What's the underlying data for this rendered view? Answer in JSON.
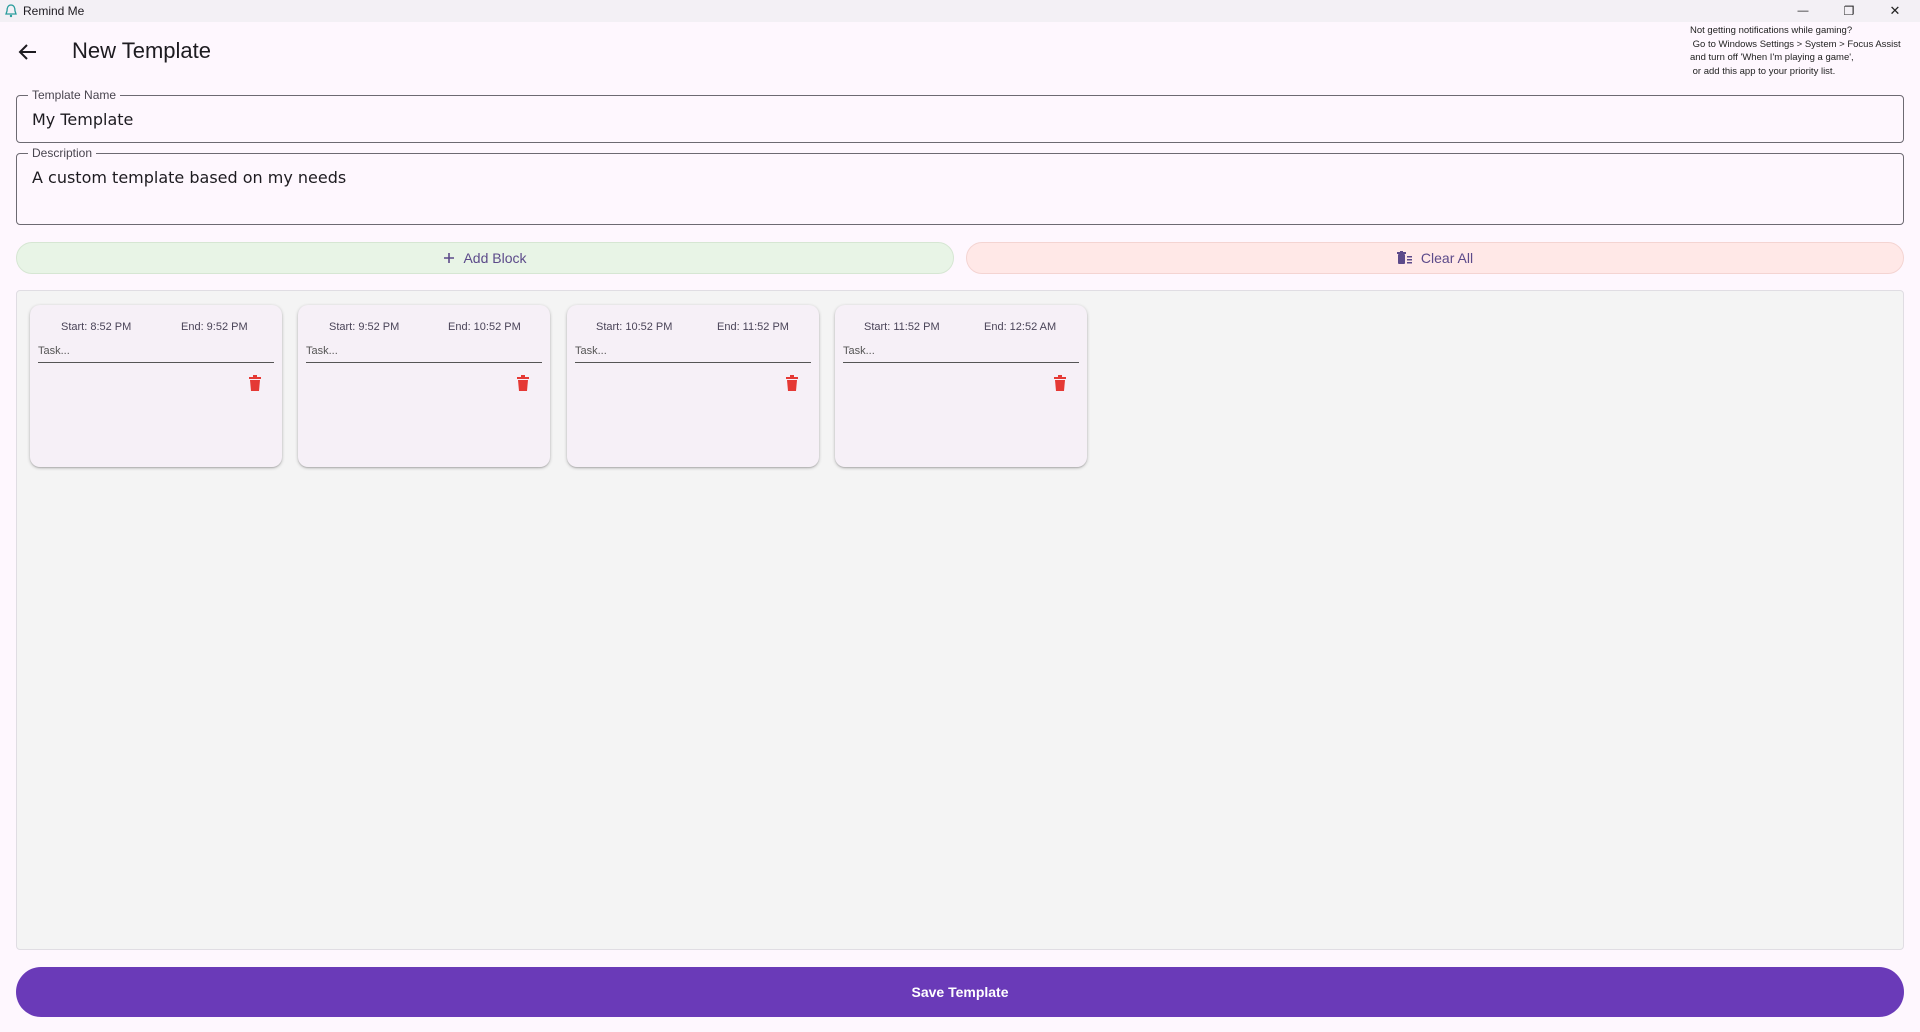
{
  "window": {
    "title": "Remind Me",
    "minimize_glyph": "—",
    "maximize_glyph": "❐",
    "close_glyph": "✕"
  },
  "header": {
    "title": "New Template",
    "back_icon": "arrow-left-icon"
  },
  "notice": {
    "text": "Not getting notifications while gaming?\n Go to Windows Settings > System > Focus Assist\nand turn off 'When I'm playing a game',\n or add this app to your priority list."
  },
  "form": {
    "name_label": "Template Name",
    "name_value": "My Template",
    "description_label": "Description",
    "description_value": "A custom template based on my needs"
  },
  "actions": {
    "add_label": "Add Block",
    "add_icon": "plus-icon",
    "clear_label": "Clear All",
    "clear_icon": "clear-list-icon"
  },
  "blocks": [
    {
      "start": "Start: 8:52 PM",
      "end": "End: 9:52 PM",
      "task_placeholder": "Task..."
    },
    {
      "start": "Start: 9:52 PM",
      "end": "End: 10:52 PM",
      "task_placeholder": "Task..."
    },
    {
      "start": "Start: 10:52 PM",
      "end": "End: 11:52 PM",
      "task_placeholder": "Task..."
    },
    {
      "start": "Start: 11:52 PM",
      "end": "End: 12:52 AM",
      "task_placeholder": "Task..."
    }
  ],
  "footer": {
    "save_label": "Save Template"
  },
  "colors": {
    "background": "#fef7fe",
    "primary": "#6a3ab8",
    "add_bg": "#e8f4e6",
    "clear_bg": "#ffe8e7",
    "delete_icon": "#e53935"
  }
}
